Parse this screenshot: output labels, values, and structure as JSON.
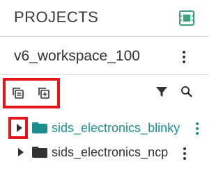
{
  "header": {
    "title": "PROJECTS",
    "right_icon": "chip-icon"
  },
  "workspace": {
    "name": "v6_workspace_100",
    "menu_icon": "kebab-icon"
  },
  "toolbar": {
    "left_icons": [
      "copy-project-icon",
      "add-project-icon"
    ],
    "right_icons": [
      "filter-icon",
      "search-icon"
    ],
    "highlight_color": "#e3161b"
  },
  "tree": {
    "items": [
      {
        "label": "sids_electronics_blinky",
        "selected": true,
        "color": "#1e8f8f",
        "icon": "folder-icon"
      },
      {
        "label": "sids_electronics_ncp",
        "selected": false,
        "color": "#333333",
        "icon": "folder-icon"
      }
    ]
  },
  "colors": {
    "accent_teal": "#1e8f8f",
    "icon_green": "#3aa57a",
    "text": "#333333",
    "divider": "#d9d9d9"
  }
}
